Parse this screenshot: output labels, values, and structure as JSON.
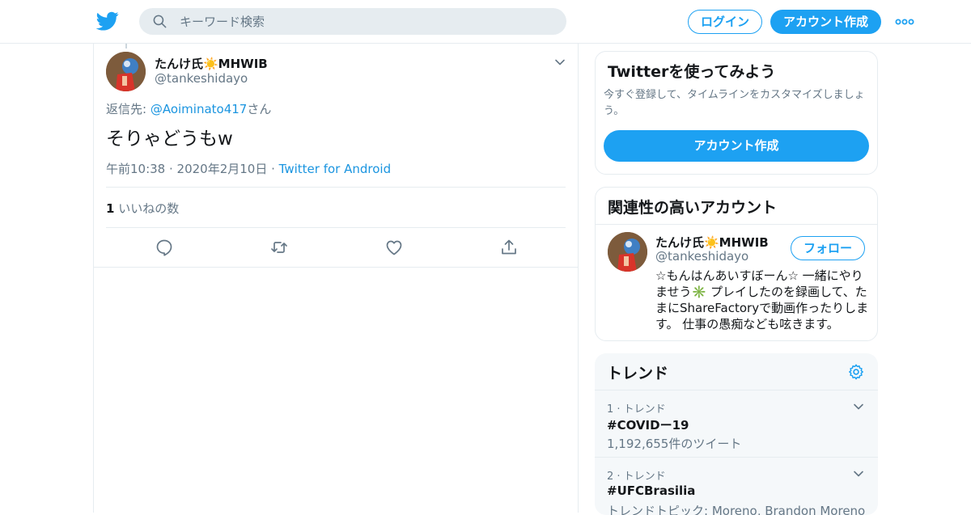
{
  "header": {
    "search_placeholder": "キーワード検索",
    "login_label": "ログイン",
    "signup_label": "アカウント作成"
  },
  "tweet": {
    "display_name": "たんけ氏☀️MHWIB",
    "handle": "@tankeshidayo",
    "reply_prefix": "返信先: ",
    "reply_mention": "@Aoiminato417",
    "reply_suffix": "さん",
    "text": "そりゃどうもw",
    "timestamp": "午前10:38 · 2020年2月10日 · ",
    "source": "Twitter for Android",
    "like_count": "1",
    "like_label": " いいねの数"
  },
  "signup_card": {
    "title": "Twitterを使ってみよう",
    "description": "今すぐ登録して、タイムラインをカスタマイズしましょう。",
    "button": "アカウント作成"
  },
  "related_card": {
    "title": "関連性の高いアカウント",
    "display_name": "たんけ氏☀️MHWIB",
    "handle": "@tankeshidayo",
    "follow_label": "フォロー",
    "bio": "☆もんはんあいすぼーん☆ 一緒にやりませう✳️ プレイしたのを録画して、たまにShareFactoryで動画作ったりします。 仕事の愚痴なども呟きます。"
  },
  "trends": {
    "title": "トレンド",
    "items": [
      {
        "rank": "1 · トレンド",
        "tag": "#COVIDー19",
        "sub": "1,192,655件のツイート"
      },
      {
        "rank": "2 · トレンド",
        "tag": "#UFCBrasilia",
        "sub": "トレンドトピック: Moreno, Brandon Moreno"
      }
    ]
  },
  "colors": {
    "brand": "#1da1f2",
    "link": "#1b95e0",
    "muted_text": "#657786",
    "border": "#e6ecf0"
  },
  "icons": [
    "twitter-bird-icon",
    "search-icon",
    "more-icon",
    "chevron-down-icon",
    "reply-icon",
    "retweet-icon",
    "like-icon",
    "share-icon",
    "gear-icon"
  ]
}
